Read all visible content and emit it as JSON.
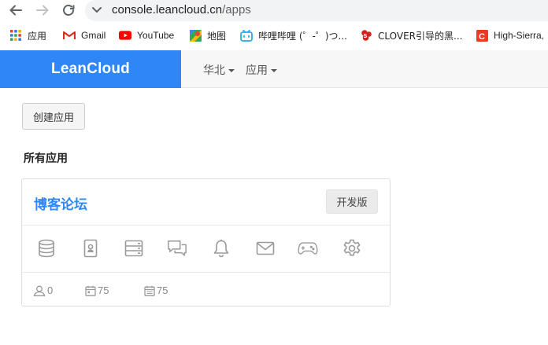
{
  "browser": {
    "url_host": "console.leancloud.cn",
    "url_path": "/apps",
    "bookmarks": [
      {
        "label": "应用",
        "icon": "apps-grid-icon"
      },
      {
        "label": "Gmail",
        "icon": "gmail-icon"
      },
      {
        "label": "YouTube",
        "icon": "youtube-icon"
      },
      {
        "label": "地图",
        "icon": "maps-icon"
      },
      {
        "label": "哔哩哔哩 (゜-゜)つ...",
        "icon": "bilibili-icon"
      },
      {
        "label": "CLOVER引导的黑...",
        "icon": "clover-icon"
      },
      {
        "label": "High-Sierra,",
        "icon": "csdn-icon"
      }
    ]
  },
  "header": {
    "brand": "LeanCloud",
    "nav": [
      {
        "label": "华北"
      },
      {
        "label": "应用"
      }
    ]
  },
  "main": {
    "create_button": "创建应用",
    "section_title": "所有应用",
    "app_card": {
      "name": "博客论坛",
      "plan_badge": "开发版",
      "services": [
        "database-icon",
        "contact-card-icon",
        "server-icon",
        "chat-icon",
        "bell-icon",
        "mail-icon",
        "gamepad-icon",
        "gear-icon"
      ],
      "stats": [
        {
          "icon": "user-icon",
          "value": "0"
        },
        {
          "icon": "calendar-icon",
          "value": "75"
        },
        {
          "icon": "calendar-icon",
          "value": "75"
        }
      ]
    }
  },
  "colors": {
    "brand_blue": "#2f86f6",
    "icon_gray": "#9a9a9a"
  }
}
